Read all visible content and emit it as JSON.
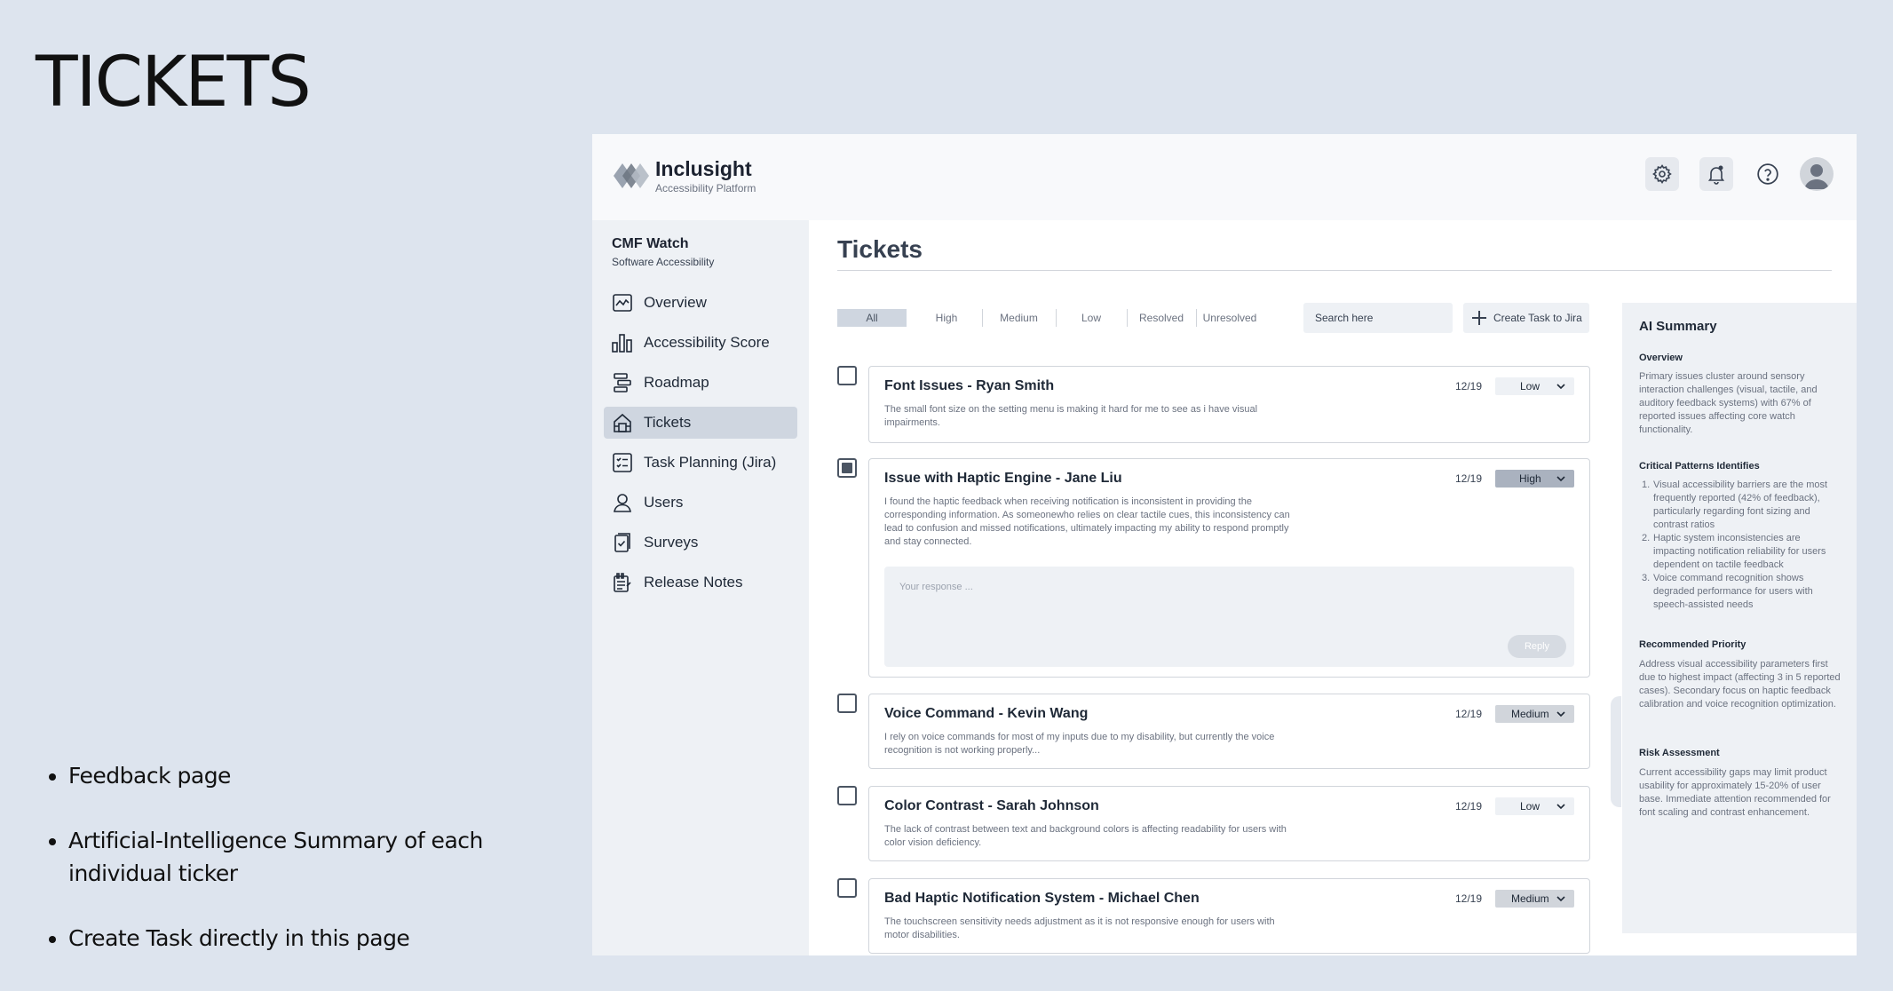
{
  "slide": {
    "title": "TICKETS",
    "bullets": [
      "Feedback page",
      "Artificial-Intelligence Summary of each individual ticker",
      "Create Task directly in this page"
    ]
  },
  "app": {
    "brand": {
      "name": "Inclusight",
      "subtitle": "Accessibility Platform"
    },
    "topbar_icons": [
      "gear-icon",
      "bell-icon",
      "help-icon",
      "avatar"
    ],
    "project": {
      "name": "CMF Watch",
      "subtitle": "Software Accessibility"
    },
    "nav": [
      {
        "label": "Overview",
        "icon": "chart-line-icon"
      },
      {
        "label": "Accessibility Score",
        "icon": "bar-chart-icon"
      },
      {
        "label": "Roadmap",
        "icon": "roadmap-icon"
      },
      {
        "label": "Tickets",
        "icon": "ticket-icon",
        "active": true
      },
      {
        "label": "Task Planning (Jira)",
        "icon": "checklist-icon"
      },
      {
        "label": "Users",
        "icon": "user-icon"
      },
      {
        "label": "Surveys",
        "icon": "survey-icon"
      },
      {
        "label": "Release Notes",
        "icon": "notes-icon"
      }
    ]
  },
  "main": {
    "title": "Tickets",
    "filters": [
      "All",
      "High",
      "Medium",
      "Low",
      "Resolved",
      "Unresolved"
    ],
    "active_filter": "All",
    "search_placeholder": "Search here",
    "create_task_label": "Create Task to Jira",
    "tickets": [
      {
        "title": "Font Issues - Ryan Smith",
        "date": "12/19",
        "priority": "Low",
        "checked": false,
        "desc": "The small font size on the setting menu is making it hard for me to see as i have visual impairments."
      },
      {
        "title": "Issue with Haptic Engine - Jane Liu",
        "date": "12/19",
        "priority": "High",
        "checked": true,
        "desc": "I found the haptic feedback when receiving notification is inconsistent in providing the corresponding information. As someonewho relies on clear tactile cues, this inconsistency can lead to confusion and missed notifications, ultimately impacting my ability to respond promptly and stay connected.",
        "response_placeholder": "Your response ...",
        "reply_label": "Reply"
      },
      {
        "title": "Voice Command - Kevin Wang",
        "date": "12/19",
        "priority": "Medium",
        "checked": false,
        "desc": "I rely on voice commands for most of my inputs due to my disability, but currently the voice recognition is not working properly..."
      },
      {
        "title": "Color Contrast - Sarah Johnson",
        "date": "12/19",
        "priority": "Low",
        "checked": false,
        "desc": "The lack of contrast between text and background colors is affecting readability for users with color vision deficiency."
      },
      {
        "title": "Bad Haptic Notification System - Michael Chen",
        "date": "12/19",
        "priority": "Medium",
        "checked": false,
        "desc": "The touchscreen sensitivity needs adjustment as it is not responsive enough for users with motor disabilities."
      }
    ]
  },
  "ai_summary": {
    "title": "AI Summary",
    "overview_heading": "Overview",
    "overview": "Primary issues cluster around sensory interaction challenges (visual, tactile, and auditory feedback systems) with 67% of reported issues affecting core watch functionality.",
    "patterns_heading": "Critical Patterns Identifies",
    "patterns": [
      "Visual accessibility barriers are the most frequently reported (42% of feedback), particularly regarding font sizing and contrast ratios",
      "Haptic system inconsistencies are impacting notification reliability for users dependent on tactile feedback",
      "Voice command recognition shows degraded performance for users with speech-assisted needs"
    ],
    "priority_heading": "Recommended Priority",
    "priority": "Address visual accessibility parameters first due to highest impact (affecting 3 in 5 reported cases). Secondary focus on haptic feedback calibration and voice recognition optimization.",
    "risk_heading": "Risk Assessment",
    "risk": "Current accessibility gaps may limit product usability for approximately 15-20% of user base. Immediate attention recommended for font scaling and contrast enhancement."
  },
  "colors": {
    "background": "#dde4ee",
    "sidebar": "#eef1f5",
    "active_nav": "#cfd6e0",
    "priority_high": "#aab2bf",
    "priority_medium": "#d1d5db",
    "priority_low": "#eef1f5"
  }
}
